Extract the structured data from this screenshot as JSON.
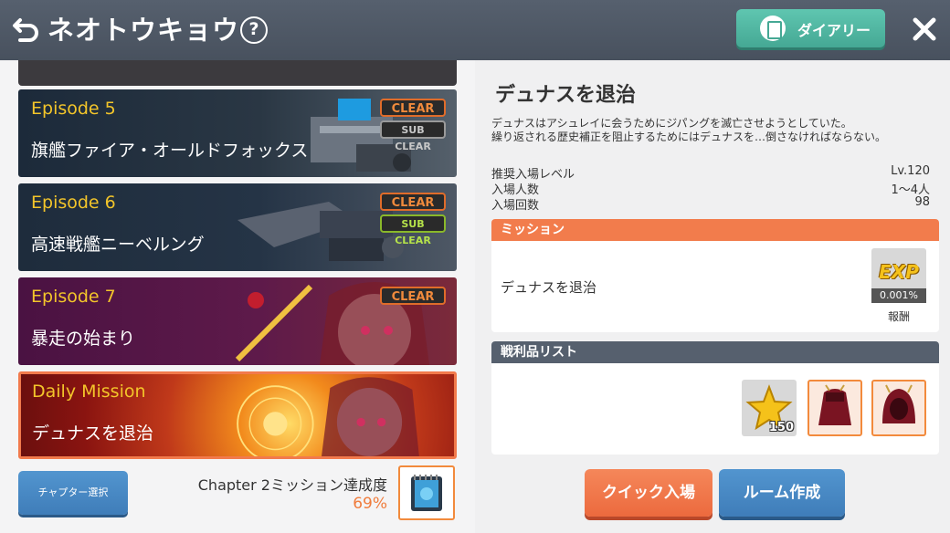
{
  "header": {
    "title": "ネオトウキョウ",
    "help_symbol": "?",
    "diary_label": "ダイアリー"
  },
  "episodes": [
    {
      "label": "Episode 5",
      "name": "旗艦ファイア・オールドフォックス",
      "clear": "CLEAR",
      "sub_clear": "SUB CLEAR",
      "sub_color": "#b0b0b0"
    },
    {
      "label": "Episode 6",
      "name": "高速戦艦ニーベルング",
      "clear": "CLEAR",
      "sub_clear": "SUB CLEAR",
      "sub_color": "#a6d43a"
    },
    {
      "label": "Episode 7",
      "name": "暴走の始まり",
      "clear": "CLEAR"
    }
  ],
  "daily": {
    "label": "Daily Mission",
    "name": "デュナスを退治"
  },
  "footer": {
    "chapter_button": "チャプター選択",
    "achievement_label": "Chapter 2ミッション達成度",
    "achievement_pct": "69%"
  },
  "detail": {
    "title": "デュナスを退治",
    "desc_line1": "デュナスはアシュレイに会うためにジパングを滅亡させようとしていた。",
    "desc_line2": "繰り返される歴史補正を阻止するためにはデュナスを…倒さなければならない。",
    "info": [
      {
        "key": "推奨入場レベル",
        "value": "Lv.120"
      },
      {
        "key": "入場人数",
        "value": "1〜4人"
      },
      {
        "key": "入場回数",
        "value": "98"
      }
    ],
    "mission_header": "ミッション",
    "mission_text": "デュナスを退治",
    "exp_text": "EXP",
    "exp_pct": "0.001%",
    "reward_label": "報酬",
    "loot_header": "戦利品リスト",
    "loot_qty": "150",
    "quick_button": "クイック入場",
    "room_button": "ルーム作成"
  }
}
